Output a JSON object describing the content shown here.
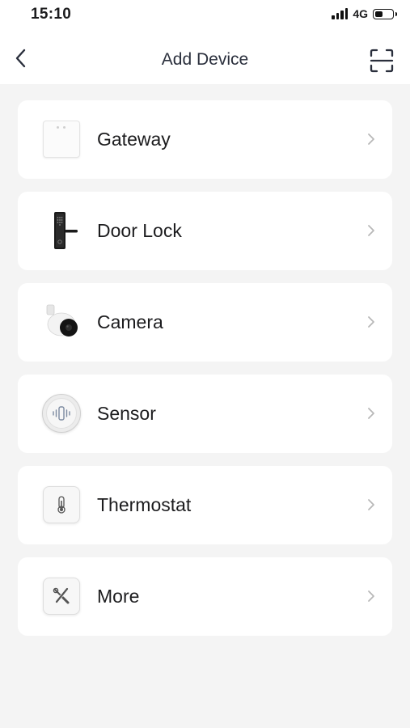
{
  "status_bar": {
    "time": "15:10",
    "network": "4G",
    "battery_level": 0.45
  },
  "nav": {
    "title": "Add Device",
    "back_icon": "chevron-left-icon",
    "scan_icon": "scan-icon"
  },
  "devices": [
    {
      "label": "Gateway",
      "icon": "gateway-icon"
    },
    {
      "label": "Door Lock",
      "icon": "door-lock-icon"
    },
    {
      "label": "Camera",
      "icon": "camera-icon"
    },
    {
      "label": "Sensor",
      "icon": "sensor-icon"
    },
    {
      "label": "Thermostat",
      "icon": "thermostat-icon"
    },
    {
      "label": "More",
      "icon": "tools-icon"
    }
  ],
  "colors": {
    "background": "#f4f4f4",
    "card": "#ffffff",
    "title": "#2a2f3c",
    "chevron": "#b8b8b8"
  }
}
